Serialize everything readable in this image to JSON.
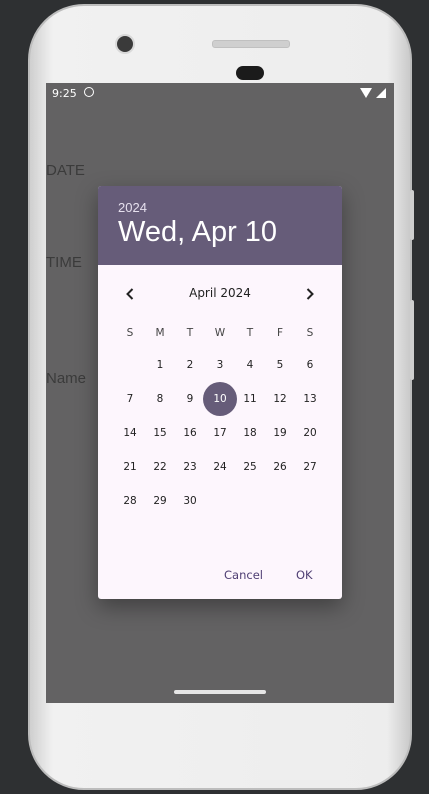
{
  "status_bar": {
    "time": "9:25"
  },
  "background": {
    "labels": [
      {
        "text": "DATE"
      },
      {
        "text": "TIME"
      },
      {
        "text": "Name"
      }
    ]
  },
  "dialog": {
    "year": "2024",
    "selected_date": "Wed, Apr 10",
    "month_label": "April 2024",
    "prev_icon": "chevron-left-icon",
    "next_icon": "chevron-right-icon",
    "weekdays": [
      "S",
      "M",
      "T",
      "W",
      "T",
      "F",
      "S"
    ],
    "days": [
      "1",
      "2",
      "3",
      "4",
      "5",
      "6",
      "7",
      "8",
      "9",
      "10",
      "11",
      "12",
      "13",
      "14",
      "15",
      "16",
      "17",
      "18",
      "19",
      "20",
      "21",
      "22",
      "23",
      "24",
      "25",
      "26",
      "27",
      "28",
      "29",
      "30"
    ],
    "selected_day": "10",
    "cancel_label": "Cancel",
    "ok_label": "OK"
  },
  "colors": {
    "header_bg": "#665c79",
    "dialog_bg": "#fdf6fd",
    "scrim": "#636263",
    "accent_text": "#4e3e73"
  }
}
